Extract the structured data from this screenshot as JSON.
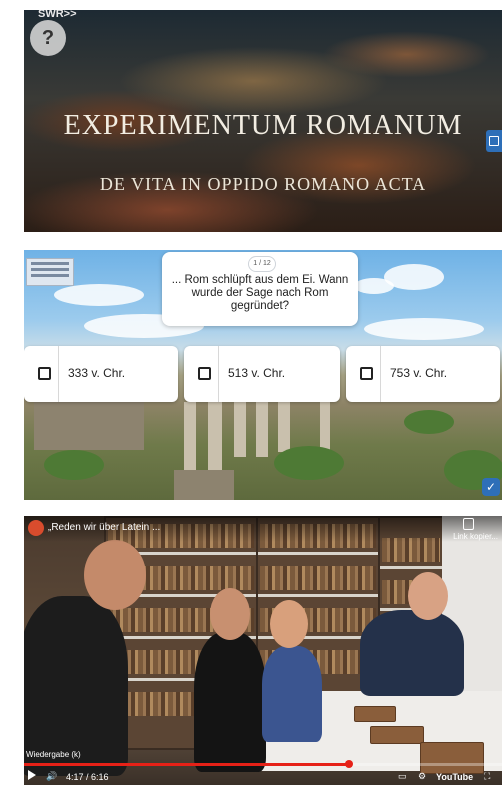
{
  "panel1": {
    "logo": "SWR>>",
    "help_label": "?",
    "title": "EXPERIMENTUM ROMANUM",
    "subtitle": "DE VITA IN OPPIDO ROMANO ACTA"
  },
  "quiz": {
    "counter": "1 / 12",
    "question": "... Rom schlüpft aus dem Ei. Wann wurde der Sage nach Rom gegründet?",
    "answers": [
      {
        "label": "333 v. Chr."
      },
      {
        "label": "513 v. Chr."
      },
      {
        "label": "753 v. Chr."
      }
    ],
    "check_icon": "check-icon"
  },
  "video": {
    "title": "„Reden wir über Latein ...",
    "copy_label": "Link kopier...",
    "status": "Wiedergabe (k)",
    "time": "4:17 / 6:16",
    "brand": "YouTube",
    "progress_fraction": 0.68
  }
}
